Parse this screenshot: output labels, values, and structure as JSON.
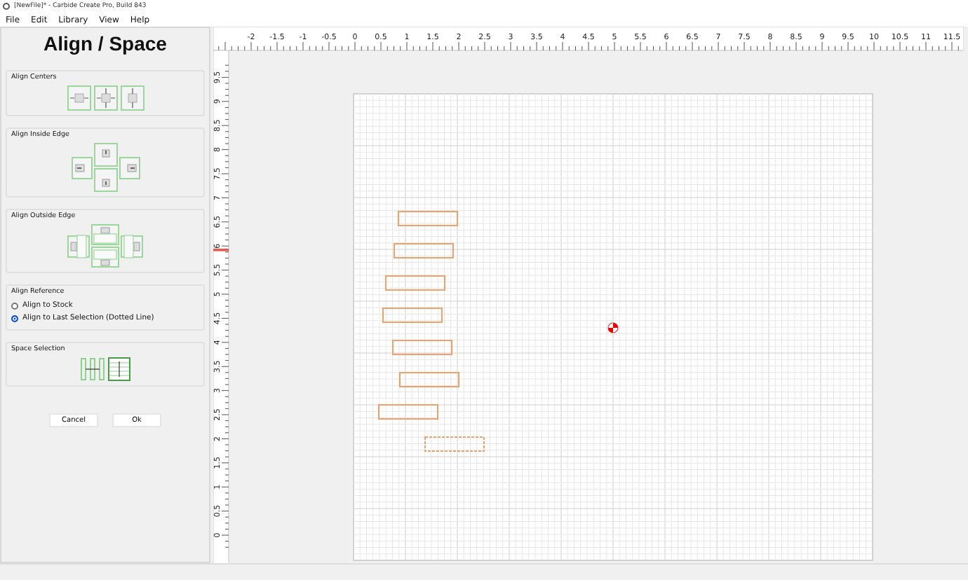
{
  "window": {
    "title": "[NewFile]* - Carbide Create Pro, Build 843"
  },
  "menu": [
    "File",
    "Edit",
    "Library",
    "View",
    "Help"
  ],
  "panel": {
    "title": "Align / Space",
    "sections": [
      {
        "kind": "align_centers",
        "label": "Align Centers"
      },
      {
        "kind": "align_inside",
        "label": "Align Inside Edge"
      },
      {
        "kind": "align_outside",
        "label": "Align Outside Edge"
      },
      {
        "kind": "reference",
        "label": "Align Reference",
        "options": [
          {
            "label": "Align to Stock",
            "selected": false
          },
          {
            "label": "Align to Last Selection (Dotted Line)",
            "selected": true
          }
        ]
      },
      {
        "kind": "space",
        "label": "Space Selection"
      }
    ],
    "buttons": [
      "Cancel",
      "Ok"
    ]
  },
  "rulers": {
    "horizontal": [
      "-2",
      "-1.5",
      "-1",
      "-0.5",
      "0",
      "0.5",
      "1",
      "1.5",
      "2",
      "2.5",
      "3",
      "3.5",
      "4",
      "4.5",
      "5",
      "5.5",
      "6",
      "6.5",
      "7",
      "7.5",
      "8",
      "8.5",
      "9",
      "9.5",
      "10",
      "10.5",
      "11",
      "11.5"
    ],
    "vertical": [
      "9.5",
      "9",
      "8.5",
      "8",
      "7.5",
      "7",
      "6.5",
      "6",
      "5.5",
      "5",
      "4.5",
      "4",
      "3.5",
      "3",
      "2.5",
      "2",
      "1.5",
      "1",
      "0.5",
      "0"
    ]
  }
}
